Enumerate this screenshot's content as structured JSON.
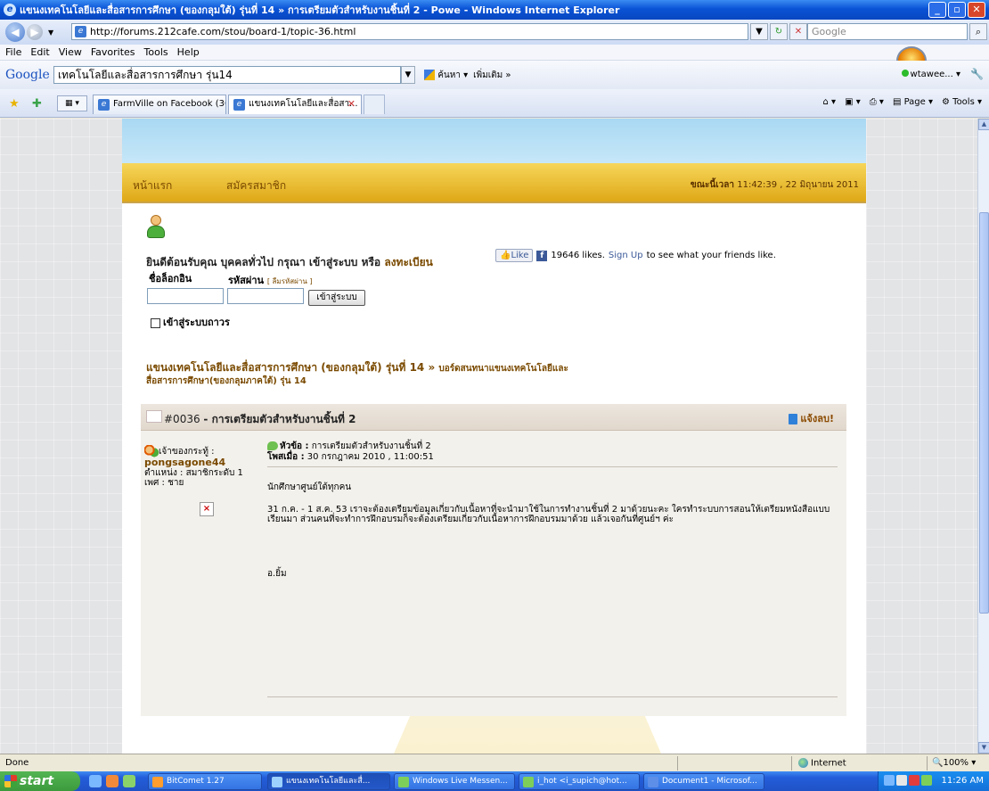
{
  "window": {
    "title": "แขนงเทคโนโลยีและสื่อสารการศึกษา (ของกลุมใต้) รุ่นที่ 14 » การเตรียมตัวสำหรับงานชิ้นที่ 2 - Powe - Windows Internet Explorer"
  },
  "address_bar": {
    "url": "http://forums.212cafe.com/stou/board-1/topic-36.html",
    "search_placeholder": "Google"
  },
  "menu": [
    "File",
    "Edit",
    "View",
    "Favorites",
    "Tools",
    "Help"
  ],
  "google_toolbar": {
    "logo": "Google",
    "query": "เทคโนโลยีและสื่อสารการศึกษา รุ่น14",
    "search_label": "ค้นหา",
    "more_label": "เพิ่มเติม »",
    "user": "wtawee..."
  },
  "tabs": [
    {
      "label": "FarmVille on Facebook (30)"
    },
    {
      "label": "แขนงเทคโนโลยีและสื่อสา..."
    }
  ],
  "command_bar": {
    "page": "Page",
    "tools": "Tools"
  },
  "site_nav": {
    "home": "หน้าแรก",
    "register": "สมัครสมาชิก",
    "now_label": "ขณะนี้เวลา",
    "now_value": "11:42:39 , 22 มิถุนายน 2011"
  },
  "login": {
    "welcome": "ยินดีต้อนรับคุณ บุคคลทั่วไป กรุณา เข้าสู่ระบบ หรือ",
    "register_link": "ลงทะเบียน",
    "username_label": "ชื่อล็อกอิน",
    "password_label": "รหัสผ่าน",
    "forgot": "[ ลืมรหัสผ่าน ]",
    "login_button": "เข้าสู่ระบบ",
    "remember": "เข้าสู่ระบบถาวร"
  },
  "facebook": {
    "like": "Like",
    "likes": "19646 likes.",
    "signup": "Sign Up",
    "suffix": "to see what your friends like."
  },
  "breadcrumb": {
    "board": "แขนงเทคโนโลยีและสื่อสารการศึกษา (ของกลุมใต้) รุ่นที่ 14 »",
    "sub_line1": "บอร์ดสนทนาแขนงเทคโนโลยีและ",
    "sub_line2": "สื่อสารการศึกษา(ของกลุมภาคใต้) รุ่น 14"
  },
  "post": {
    "number": "#0036",
    "title": "- การเตรียมตัวสำหรับงานชิ้นที่ 2",
    "report": "แจ้งลบ!",
    "owner_label": "เจ้าของกระทู้ :",
    "author": "pongsagone44",
    "position": "ตำแหน่ง : สมาชิกระดับ 1",
    "gender": "เพศ : ชาย",
    "subject_label": "หัวข้อ :",
    "subject": "การเตรียมตัวสำหรับงานชิ้นที่ 2",
    "posted_label": "โพสเมื่อ :",
    "posted": "30 กรกฎาคม 2010 , 11:00:51",
    "greeting": "นักศึกษาศูนย์ใต้ทุกคน",
    "body": "31 ก.ค. - 1 ส.ค. 53 เราจะต้องเตรียมข้อมูลเกี่ยวกับเนื้อหาที่จะนำมาใช้ในการทำงานชิ้นที่ 2 มาด้วยนะคะ  ใครทำระบบการสอนให้เตรียมหนังสือแบบเรียนมา  ส่วนคนที่จะทำการฝึกอบรมก็จะต้องเตรียมเกี่ยวกับเนื้อหาการฝึกอบรมมาด้วย  แล้วเจอกันที่ศูนย์ฯ ค่ะ",
    "signature": "อ.ยิ้ม"
  },
  "status": {
    "done": "Done",
    "zone": "Internet",
    "zoom": "100%"
  },
  "taskbar": {
    "start": "start",
    "items": [
      "BitComet 1.27",
      "แขนงเทคโนโลยีและสื่...",
      "Windows Live Messen...",
      "i_hot <i_supich@hot...",
      "Document1 - Microsof..."
    ],
    "clock": "11:26 AM"
  }
}
